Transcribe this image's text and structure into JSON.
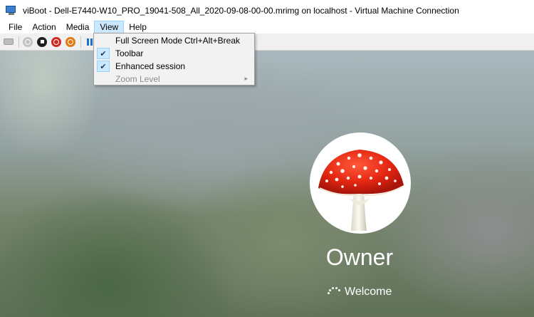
{
  "window": {
    "title": "viBoot - Dell-E7440-W10_PRO_19041-508_All_2020-09-08-00-00.mrimg on localhost - Virtual Machine Connection"
  },
  "menubar": {
    "items": [
      {
        "label": "File"
      },
      {
        "label": "Action"
      },
      {
        "label": "Media"
      },
      {
        "label": "View"
      },
      {
        "label": "Help"
      }
    ],
    "active": "View"
  },
  "toolbar": {
    "buttons": [
      "ctrl-alt-del-icon",
      "start-icon",
      "turn-off-icon",
      "shut-down-icon",
      "save-icon",
      "pause-icon"
    ]
  },
  "view_menu": {
    "items": [
      {
        "label": "Full Screen Mode",
        "shortcut": "Ctrl+Alt+Break",
        "checked": false,
        "enabled": true
      },
      {
        "label": "Toolbar",
        "checked": true,
        "enabled": true
      },
      {
        "label": "Enhanced session",
        "checked": true,
        "enabled": true
      },
      {
        "label": "Zoom Level",
        "checked": false,
        "enabled": false,
        "submenu": true
      }
    ],
    "check_glyph": "✔",
    "submenu_glyph": "▸"
  },
  "lock_screen": {
    "user_name": "Owner",
    "status": "Welcome",
    "avatar": "fly-agaric-mushroom"
  },
  "colors": {
    "menu_highlight": "#cce8ff",
    "menu_highlight_border": "#99d1ff",
    "toolbar_bg": "#f0f0f0",
    "red_button": "#d02820",
    "orange_button": "#e07a10",
    "pause_blue": "#1e70c8"
  }
}
